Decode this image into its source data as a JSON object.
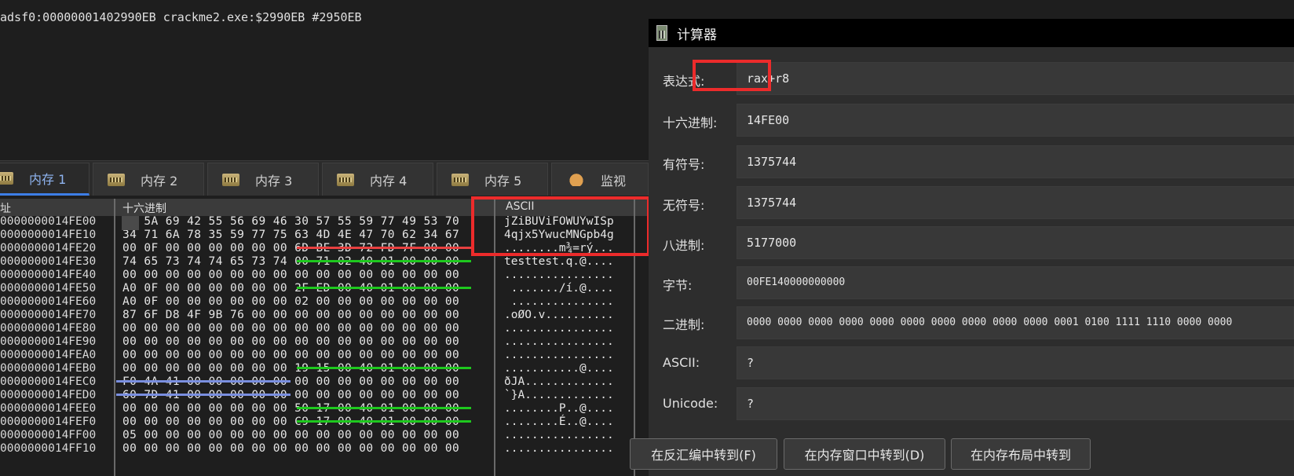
{
  "info": {
    "line": "adsf0:00000001402990EB crackme2.exe:$2990EB #2950EB"
  },
  "tabs": [
    {
      "label": "内存 1",
      "icon": "memory-icon"
    },
    {
      "label": "内存 2",
      "icon": "memory-icon"
    },
    {
      "label": "内存 3",
      "icon": "memory-icon"
    },
    {
      "label": "内存 4",
      "icon": "memory-icon"
    },
    {
      "label": "内存 5",
      "icon": "memory-icon"
    },
    {
      "label": "监视",
      "icon": "watch-cat-icon"
    }
  ],
  "memory": {
    "headers": {
      "address": "址",
      "hex": "十六进制",
      "ascii": "ASCII"
    },
    "rows": [
      {
        "addr": "0000000014FE00",
        "hex": "6A 5A 69 42 55 56 69 46 30 57 55 59 77 49 53 70",
        "ascii": "jZiBUViFOWUYwISp"
      },
      {
        "addr": "0000000014FE10",
        "hex": "34 71 6A 78 35 59 77 75 63 4D 4E 47 70 62 34 67",
        "ascii": "4qjx5YwucMNGpb4g"
      },
      {
        "addr": "0000000014FE20",
        "hex": "00 0F 00 00 00 00 00 00 6D BE 3D 72 FD 7F 00 00",
        "ascii": "........m¾=rý..."
      },
      {
        "addr": "0000000014FE30",
        "hex": "74 65 73 74 74 65 73 74 00 71 02 40 01 00 00 00",
        "ascii": "testtest.q.@...."
      },
      {
        "addr": "0000000014FE40",
        "hex": "00 00 00 00 00 00 00 00 00 00 00 00 00 00 00 00",
        "ascii": "................"
      },
      {
        "addr": "0000000014FE50",
        "hex": "A0 0F 00 00 00 00 00 00 2F ED 00 40 01 00 00 00",
        "ascii": " ......./í.@...."
      },
      {
        "addr": "0000000014FE60",
        "hex": "A0 0F 00 00 00 00 00 00 02 00 00 00 00 00 00 00",
        "ascii": " ..............."
      },
      {
        "addr": "0000000014FE70",
        "hex": "87 6F D8 4F 9B 76 00 00 00 00 00 00 00 00 00 00",
        "ascii": ".oØO.v.........."
      },
      {
        "addr": "0000000014FE80",
        "hex": "00 00 00 00 00 00 00 00 00 00 00 00 00 00 00 00",
        "ascii": "................"
      },
      {
        "addr": "0000000014FE90",
        "hex": "00 00 00 00 00 00 00 00 00 00 00 00 00 00 00 00",
        "ascii": "................"
      },
      {
        "addr": "0000000014FEA0",
        "hex": "00 00 00 00 00 00 00 00 00 00 00 00 00 00 00 00",
        "ascii": "................"
      },
      {
        "addr": "0000000014FEB0",
        "hex": "00 00 00 00 00 00 00 00 19 15 00 40 01 00 00 00",
        "ascii": "...........@...."
      },
      {
        "addr": "0000000014FEC0",
        "hex": "F0 4A 41 00 00 00 00 00 00 00 00 00 00 00 00 00",
        "ascii": "ðJA............."
      },
      {
        "addr": "0000000014FED0",
        "hex": "60 7D 41 00 00 00 00 00 00 00 00 00 00 00 00 00",
        "ascii": "`}A............."
      },
      {
        "addr": "0000000014FEE0",
        "hex": "00 00 00 00 00 00 00 00 50 17 00 40 01 00 00 00",
        "ascii": "........P..@...."
      },
      {
        "addr": "0000000014FEF0",
        "hex": "00 00 00 00 00 00 00 00 C9 17 00 40 01 00 00 00",
        "ascii": "........É..@...."
      },
      {
        "addr": "0000000014FF00",
        "hex": "05 00 00 00 00 00 00 00 00 00 00 00 00 00 00 00",
        "ascii": "................"
      },
      {
        "addr": "0000000014FF10",
        "hex": "00 00 00 00 00 00 00 00 00 00 00 00 00 00 00 00",
        "ascii": "................"
      }
    ]
  },
  "calculator": {
    "title": "计算器",
    "fields": [
      {
        "label": "表达式:",
        "value": "rax+r8"
      },
      {
        "label": "十六进制:",
        "value": "14FE00"
      },
      {
        "label": "有符号:",
        "value": "1375744"
      },
      {
        "label": "无符号:",
        "value": "1375744"
      },
      {
        "label": "八进制:",
        "value": "5177000"
      },
      {
        "label": "字节:",
        "value": "00FE140000000000"
      },
      {
        "label": "二进制:",
        "value": "0000 0000 0000 0000 0000 0000 0000 0000 0000 0000 0001 0100 1111 1110 0000 0000"
      },
      {
        "label": "ASCII:",
        "value": "?"
      },
      {
        "label": "Unicode:",
        "value": "?"
      }
    ],
    "buttons": {
      "goto_disasm": "在反汇编中转到(F)",
      "goto_dump": "在内存窗口中转到(D)",
      "goto_memmap": "在内存布局中转到"
    }
  }
}
